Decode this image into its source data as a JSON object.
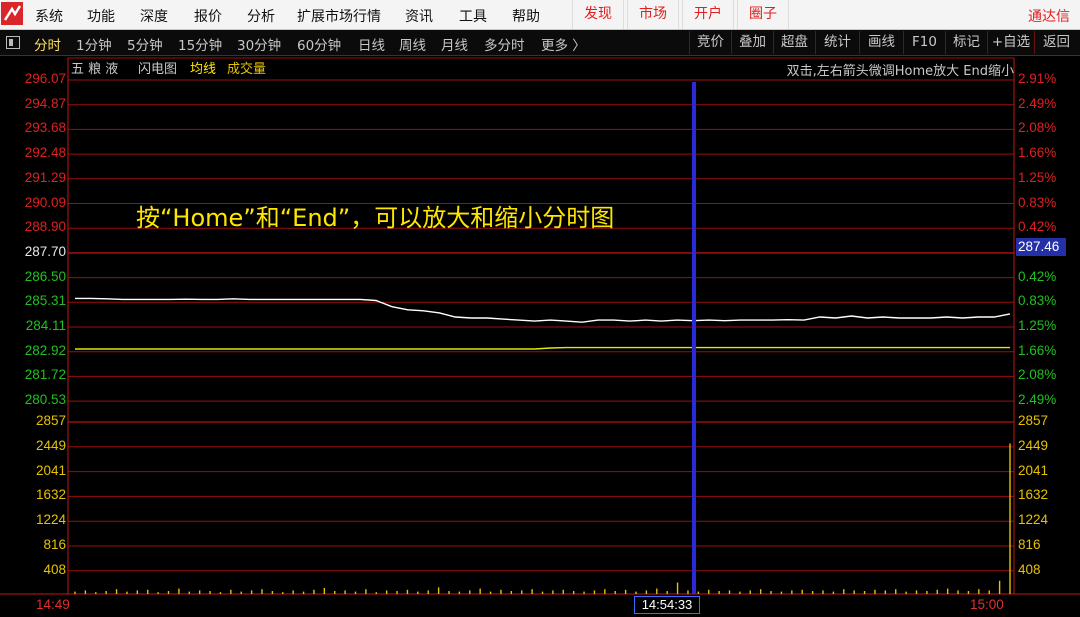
{
  "menu": {
    "items": [
      "系统",
      "功能",
      "深度",
      "报价",
      "分析",
      "扩展市场行情",
      "资讯",
      "工具",
      "帮助"
    ],
    "red_items": [
      "发现",
      "市场",
      "开户",
      "圈子"
    ],
    "brand": "通达信"
  },
  "toolbar": {
    "periods": [
      "分时",
      "1分钟",
      "5分钟",
      "15分钟",
      "30分钟",
      "60分钟",
      "日线",
      "周线",
      "月线",
      "多分时",
      "更多 〉"
    ],
    "active_period": "分时",
    "right_buttons": [
      "竞价",
      "叠加",
      "超盘",
      "统计",
      "画线",
      "F10",
      "标记",
      "+自选",
      "返回"
    ]
  },
  "chart": {
    "stock_name": "五 粮 液",
    "chart_kind": "闪电图",
    "avg_legend": "均线",
    "vol_legend": "成交量",
    "hint": "双击,左右箭头微调Home放大 End缩小",
    "overlay": "按“Home”和“End”，可以放大和缩小分时图",
    "price_labels": [
      "296.07",
      "294.87",
      "293.68",
      "292.48",
      "291.29",
      "290.09",
      "288.90",
      "287.70",
      "286.50",
      "285.31",
      "284.11",
      "282.92",
      "281.72",
      "280.53"
    ],
    "pct_labels": [
      "2.91%",
      "2.49%",
      "2.08%",
      "1.66%",
      "1.25%",
      "0.83%",
      "0.42%",
      "287.46",
      "0.42%",
      "0.83%",
      "1.25%",
      "1.66%",
      "2.08%",
      "2.49%"
    ],
    "volume_labels": [
      "2857",
      "2449",
      "2041",
      "1632",
      "1224",
      "816",
      "408"
    ],
    "current_price": "287.46",
    "time_start": "14:49",
    "time_cursor": "14:54:33",
    "time_end": "15:00",
    "colors": {
      "up": "#e02020",
      "down": "#20c020",
      "price_line": "#ffffff",
      "avg_line": "#e6e600",
      "cursor": "#2a2ad8",
      "grid": "#9a0f0f"
    }
  },
  "chart_data": {
    "type": "line",
    "title": "",
    "xlabel": "",
    "ylabel": "",
    "x_range": [
      "14:49",
      "15:00"
    ],
    "ylim": [
      280.53,
      296.07
    ],
    "series": [
      {
        "name": "",
        "values": [
          285.5,
          285.5,
          285.48,
          285.45,
          285.45,
          285.45,
          285.45,
          285.46,
          285.45,
          285.45,
          285.48,
          285.45,
          285.45,
          285.45,
          285.45,
          285.45,
          285.45,
          285.45,
          285.45,
          285.4,
          285.1,
          284.95,
          284.9,
          284.8,
          284.6,
          284.55,
          284.55,
          284.5,
          284.45,
          284.4,
          284.45,
          284.4,
          284.35,
          284.45,
          284.45,
          284.4,
          284.45,
          284.4,
          284.45,
          284.42,
          284.45,
          284.42,
          284.45,
          284.45,
          284.45,
          284.47,
          284.45,
          284.6,
          284.55,
          284.65,
          284.55,
          284.6,
          284.55,
          284.55,
          284.55,
          284.6,
          284.55,
          284.6,
          284.6,
          284.75
        ]
      },
      {
        "name": "",
        "values": [
          283.05,
          283.05,
          283.05,
          283.05,
          283.05,
          283.05,
          283.05,
          283.05,
          283.05,
          283.05,
          283.05,
          283.05,
          283.05,
          283.05,
          283.05,
          283.05,
          283.05,
          283.05,
          283.05,
          283.05,
          283.05,
          283.05,
          283.05,
          283.05,
          283.05,
          283.05,
          283.05,
          283.05,
          283.05,
          283.05,
          283.1,
          283.12,
          283.12,
          283.12,
          283.12,
          283.12,
          283.12,
          283.12,
          283.12,
          283.12,
          283.12,
          283.12,
          283.12,
          283.12,
          283.12,
          283.12,
          283.12,
          283.12,
          283.12,
          283.12,
          283.12,
          283.12,
          283.12,
          283.12,
          283.12,
          283.12,
          283.12,
          283.12,
          283.12,
          283.12
        ]
      }
    ],
    "volume": {
      "ylim": [
        0,
        2857
      ],
      "values": [
        40,
        60,
        30,
        50,
        80,
        40,
        60,
        70,
        30,
        50,
        90,
        40,
        60,
        50,
        30,
        70,
        40,
        60,
        80,
        50,
        30,
        60,
        40,
        70,
        100,
        50,
        60,
        40,
        80,
        30,
        60,
        50,
        70,
        40,
        60,
        110,
        50,
        40,
        60,
        90,
        40,
        70,
        50,
        60,
        80,
        40,
        60,
        70,
        50,
        40,
        60,
        80,
        50,
        70,
        40,
        60,
        90,
        50,
        190,
        60,
        40,
        70,
        50,
        60,
        40,
        60,
        80,
        50,
        40,
        60,
        70,
        50,
        60,
        40,
        80,
        60,
        50,
        70,
        60,
        80,
        40,
        60,
        50,
        70,
        90,
        60,
        50,
        80,
        60,
        220,
        2500
      ]
    }
  }
}
